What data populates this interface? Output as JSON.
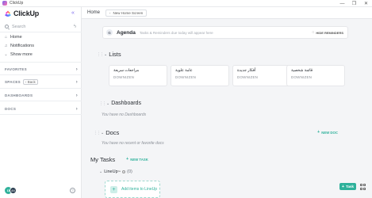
{
  "window": {
    "title": "ClickUp",
    "controls": {
      "minimize": "—",
      "maximize": "❐",
      "close": "✕"
    }
  },
  "sidebar": {
    "brand": "ClickUp",
    "collapse_icon": "«",
    "search_placeholder": "Search",
    "nav": [
      {
        "label": "Home",
        "icon": "home-icon"
      },
      {
        "label": "Notifications",
        "icon": "bell-icon"
      },
      {
        "label": "Show more",
        "icon": "chevron-down-icon"
      }
    ],
    "sections": {
      "favorites": "FAVORITES",
      "spaces": "SPACES",
      "back": "Back",
      "dashboards": "DASHBOARDS",
      "docs": "DOCS"
    },
    "avatar_initial": "D",
    "avatar2_initials": "AN",
    "help": "?"
  },
  "topbar": {
    "home": "Home",
    "new_home_screen": "New Home Screen"
  },
  "greeting": {
    "avatar": "G",
    "title": "Agenda",
    "subtitle": "Tasks & Reminders due today will appear here",
    "hide_label": "HIDE REMINDERS"
  },
  "lists": {
    "title": "Lists",
    "items": [
      {
        "name": "مراجعات سريعة",
        "space": "DOWNIZEN"
      },
      {
        "name": "عامة علوية",
        "space": "DOWNIZEN"
      },
      {
        "name": "أفكار جديدة",
        "space": "DOWNIZEN"
      },
      {
        "name": "قائمة شخصية",
        "space": "DOWNIZEN"
      }
    ]
  },
  "dashboards": {
    "title": "Dashboards",
    "empty": "You have no Dashboards"
  },
  "docs": {
    "title": "Docs",
    "new_label": "NEW DOC",
    "empty": "You have no recent or favorite docs"
  },
  "my_tasks": {
    "title": "My Tasks",
    "new_label": "NEW TASK",
    "lineup": {
      "label": "LineUp",
      "tm": "™",
      "info": "i",
      "count": "(0)",
      "add_label": "Add items to LineUp"
    }
  },
  "footer": {
    "task_button": "Task"
  },
  "colors": {
    "accent_green": "#2fb19b",
    "brand_purple": "#7b68ee"
  }
}
